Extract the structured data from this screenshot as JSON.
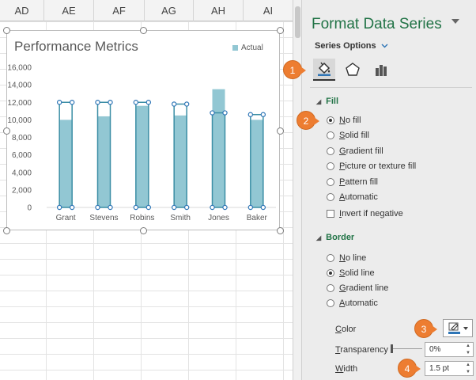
{
  "spreadsheet": {
    "columns": [
      "AD",
      "AE",
      "AF",
      "AG",
      "AH",
      "AI"
    ]
  },
  "chart_data": {
    "type": "bar",
    "title": "Performance Metrics",
    "categories": [
      "Grant",
      "Stevens",
      "Robins",
      "Smith",
      "Jones",
      "Baker"
    ],
    "series": [
      {
        "name": "Actual",
        "values": [
          10000,
          10400,
          11600,
          10500,
          13500,
          10000
        ],
        "color": "#92c7d3"
      },
      {
        "values": [
          12000,
          12000,
          12000,
          11800,
          10800,
          10600
        ],
        "style": "no-fill-outline",
        "color": "#3b8ea5"
      }
    ],
    "yticks": [
      "0",
      "2,000",
      "4,000",
      "6,000",
      "8,000",
      "10,000",
      "12,000",
      "14,000",
      "16,000"
    ],
    "ylim": [
      0,
      16000
    ],
    "grid": false,
    "legend": "top-right",
    "selected_series_index": 1
  },
  "pane": {
    "title": "Format Data Series",
    "series_options_label": "Series Options",
    "fill": {
      "heading": "Fill",
      "options": [
        "No fill",
        "Solid fill",
        "Gradient fill",
        "Picture or texture fill",
        "Pattern fill",
        "Automatic"
      ],
      "selected": "No fill",
      "invert_label": "Invert if negative"
    },
    "border": {
      "heading": "Border",
      "options": [
        "No line",
        "Solid line",
        "Gradient line",
        "Automatic"
      ],
      "selected": "Solid line"
    },
    "color_label": "Color",
    "transparency_label": "Transparency",
    "transparency_value": "0%",
    "width_label": "Width",
    "width_value": "1.5 pt",
    "accent_color": "#217346"
  },
  "callouts": [
    "1",
    "2",
    "3",
    "4"
  ],
  "callout_color": "#ed7d31"
}
